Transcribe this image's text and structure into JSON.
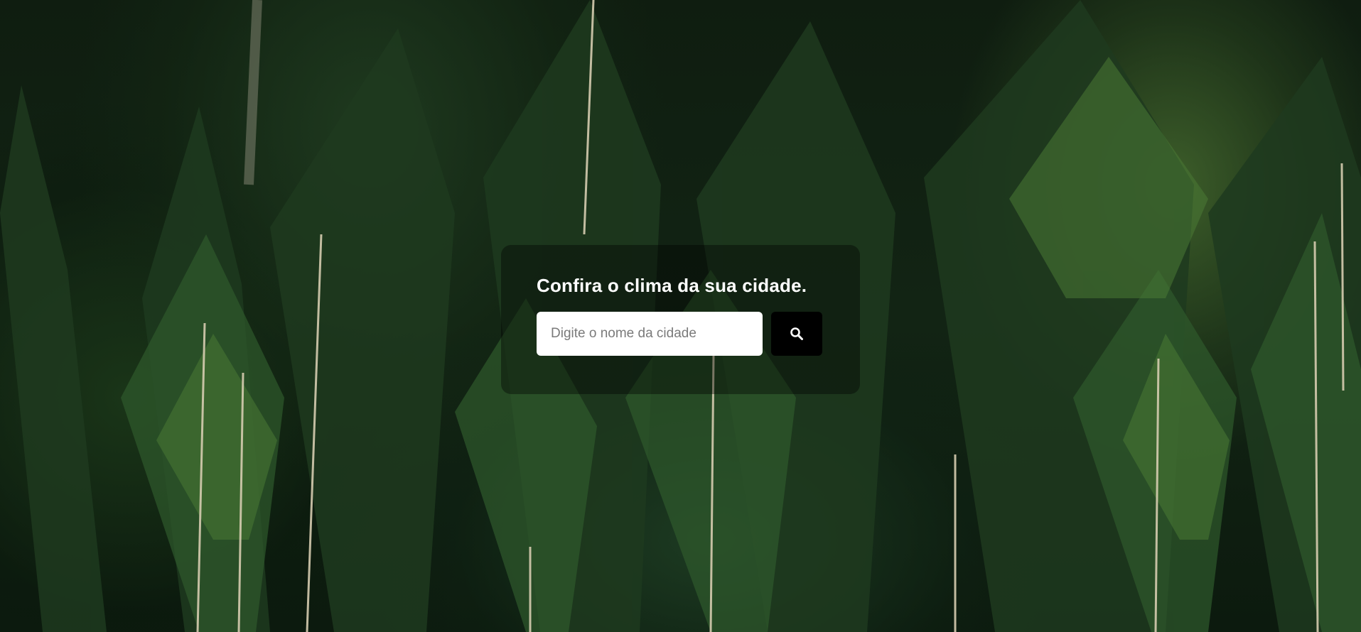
{
  "search_card": {
    "title": "Confira o clima da sua cidade.",
    "input_placeholder": "Digite o nome da cidade",
    "input_value": "",
    "button_icon": "search-icon"
  },
  "colors": {
    "card_overlay": "#000000",
    "title_text": "#ffffff",
    "input_background": "#ffffff",
    "button_background": "#000000",
    "forest_dark": "#0f1d10",
    "forest_light": "#3d5e2a"
  }
}
